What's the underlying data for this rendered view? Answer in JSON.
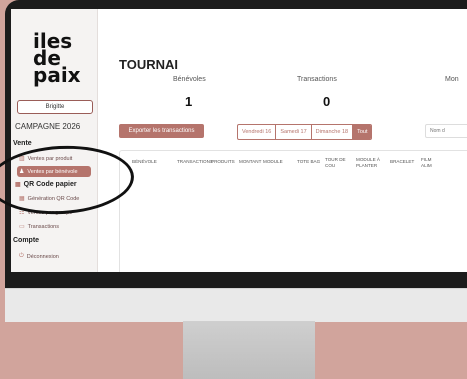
{
  "sidebar": {
    "logo_lines": [
      "iles",
      "de",
      "paix"
    ],
    "user_name": "Brigitte",
    "campaign": "CAMPAGNE 2026",
    "section_vente": "Vente",
    "items": [
      {
        "label": "Ventes par produit",
        "icon": "bar-chart-icon"
      },
      {
        "label": "Ventes par bénévole",
        "icon": "person-icon"
      },
      {
        "label": "QR Code papier",
        "icon": "qr-icon"
      },
      {
        "label": "Génération QR Code",
        "icon": "qr-icon"
      },
      {
        "label": "Ventes par groupe",
        "icon": "group-icon"
      },
      {
        "label": "Transactions",
        "icon": "card-icon"
      }
    ],
    "section_compte": "Compte",
    "logout": "Déconnexion"
  },
  "main": {
    "title": "TOURNAI",
    "stats": [
      {
        "label": "Bénévoles",
        "value": "1"
      },
      {
        "label": "Transactions",
        "value": "0"
      },
      {
        "label": "Mon",
        "value": ""
      }
    ],
    "export_label": "Exporter les transactions",
    "filters": [
      {
        "label": "Vendredi 16",
        "active": false
      },
      {
        "label": "Samedi 17",
        "active": false
      },
      {
        "label": "Dimanche 18",
        "active": false
      },
      {
        "label": "Tout",
        "active": true
      }
    ],
    "search_placeholder": "Nom d",
    "columns": [
      "BÉNÉVOLE",
      "TRANSACTIONS",
      "PRODUITS",
      "MONTANT",
      "MODULE",
      "TOTE BAG",
      "TOUR DE COU",
      "MODULE À PLANTER",
      "BRACELET",
      "FILM ALIM"
    ]
  },
  "colors": {
    "accent": "#b5746c",
    "background": "#d1a49c"
  }
}
